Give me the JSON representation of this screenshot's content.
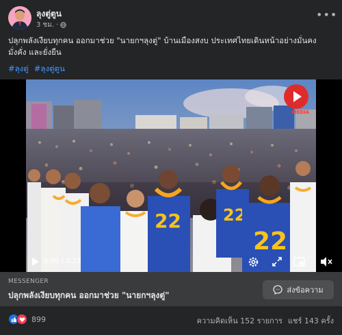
{
  "post": {
    "author": "ลุงตู่ตูน",
    "time": "3 ชม.",
    "separator": "·",
    "audience_icon": "globe-icon",
    "more_icon": "more-horizontal-icon",
    "more_label": "•••",
    "caption": "ปลุกพลังเงียบทุกคน ออกมาช่วย \"นายกฯลุงตู่\" บ้านเมืองสงบ ประเทศไทยเดินหน้าอย่างมั่นคง มั่งคั่ง และยั่งยืน",
    "hashtags": [
      "#ลุงตู่",
      "#ลุงตู่ตูน"
    ]
  },
  "video": {
    "time_display": "0:00 / 2:23",
    "badge_label": "MEDIA",
    "shirt_number": "22",
    "icons": [
      "play-icon",
      "settings-icon",
      "fullscreen-icon",
      "picture-in-picture-icon",
      "volume-muted-icon"
    ]
  },
  "cta": {
    "source": "MESSENGER",
    "title": "ปลุกพลังเงียบทุกคน ออกมาช่วย \"นายกฯลุงตู่\"",
    "button_label": "ส่งข้อความ",
    "button_icon": "messenger-icon"
  },
  "footer": {
    "reaction_count": "899",
    "comments": "ความคิดเห็น 152 รายการ",
    "shares": "แชร์ 143 ครั้ง"
  },
  "colors": {
    "background": "#242526",
    "link": "#4599ff",
    "like": "#1b74e4",
    "love": "#f33e58",
    "shirt_blue": "#2a4fb5",
    "garland": "#f7a51c"
  }
}
